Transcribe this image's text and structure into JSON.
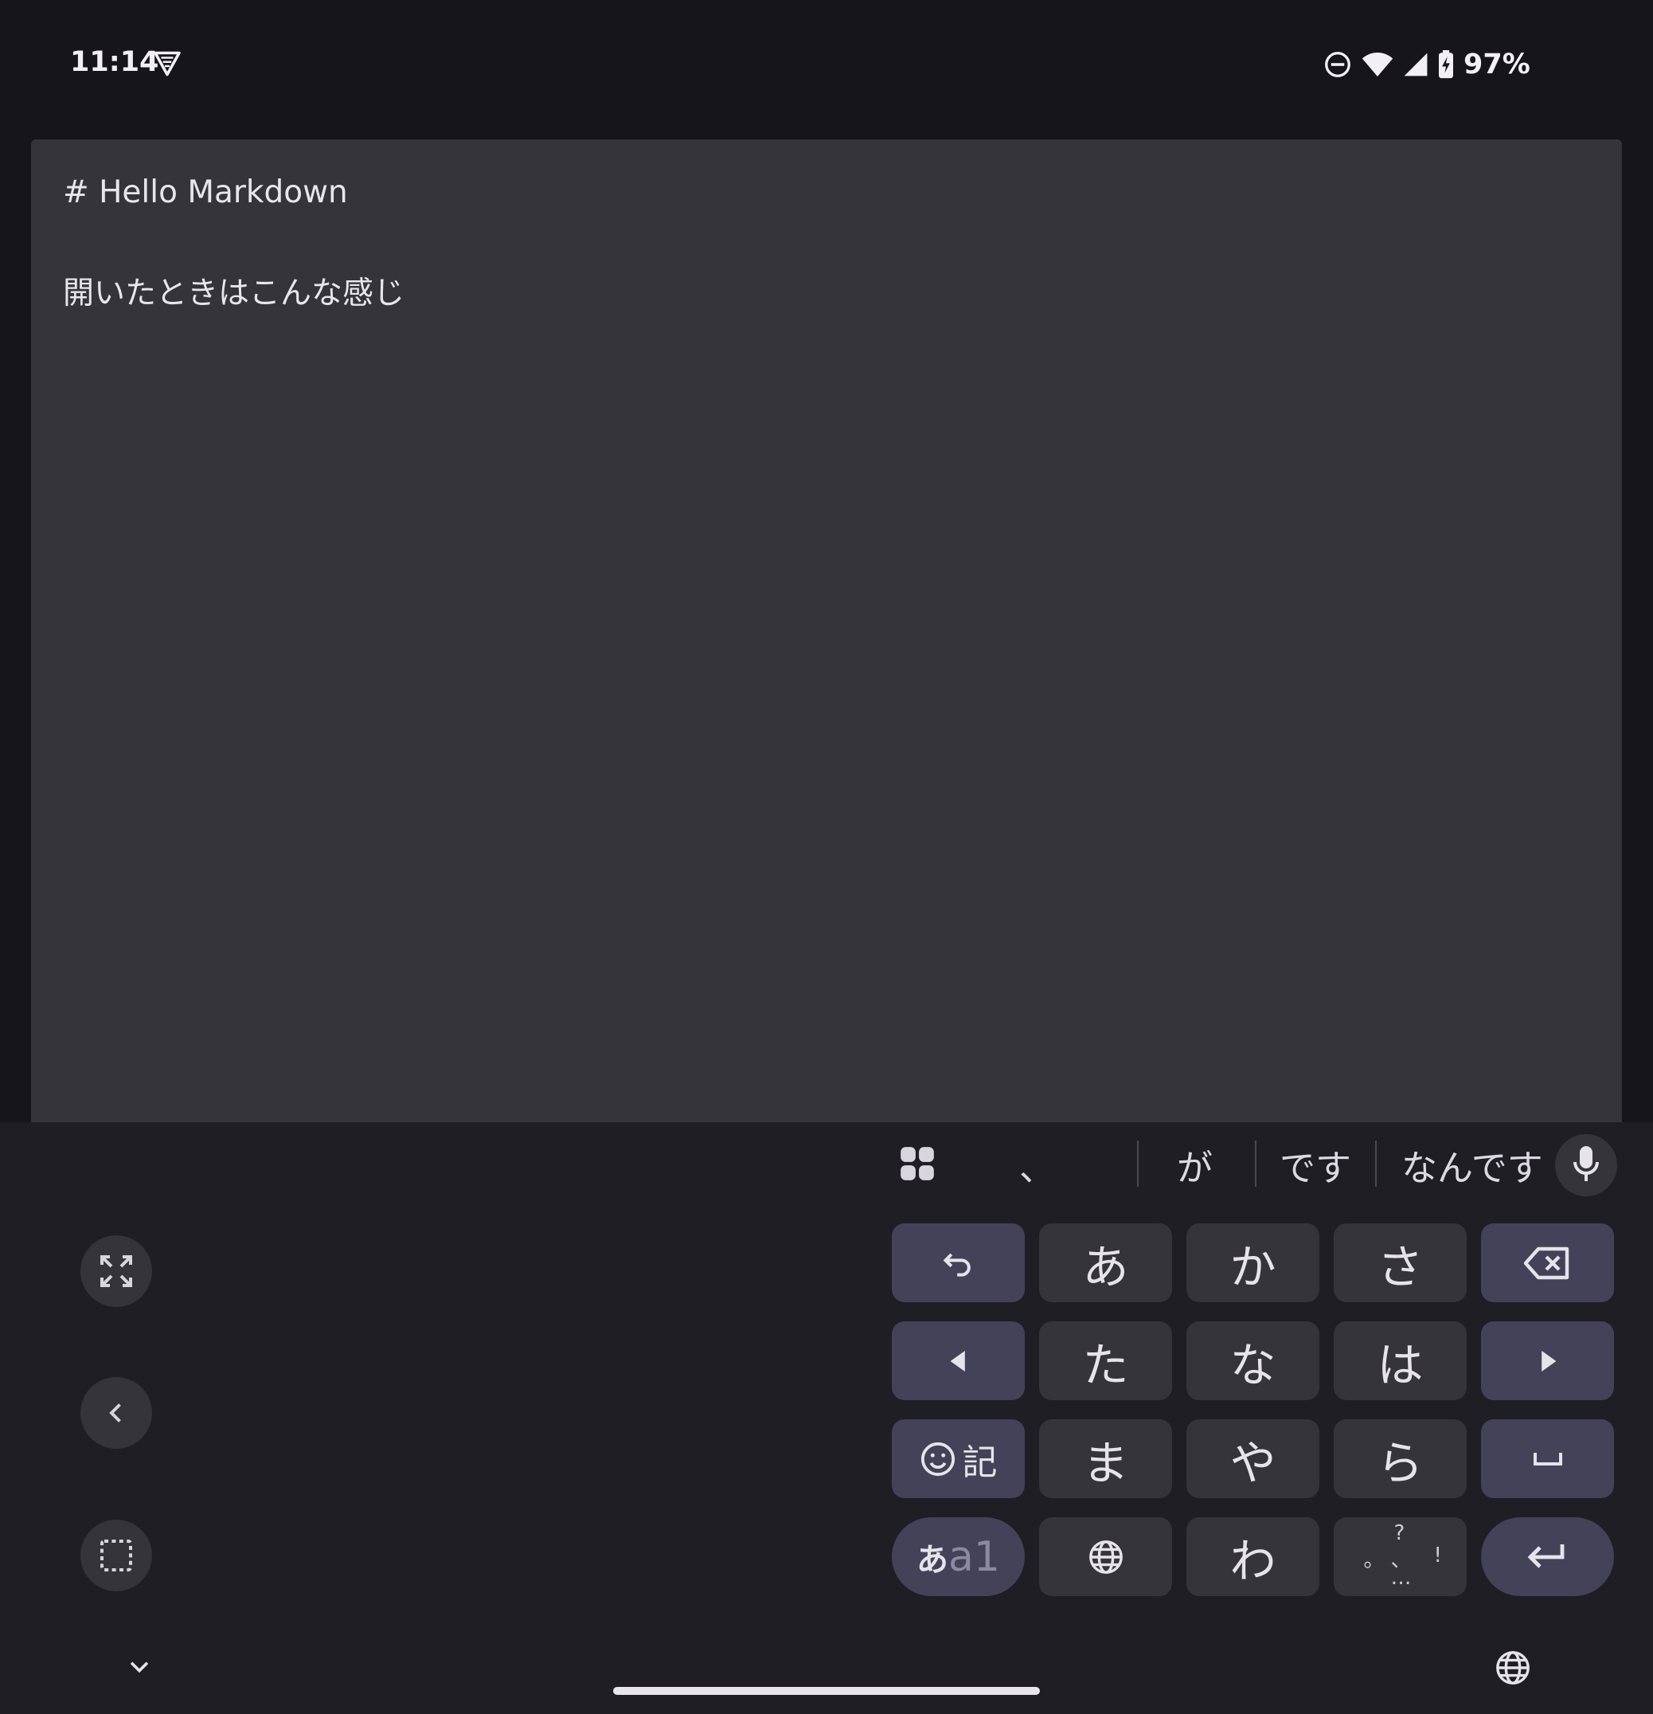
{
  "status_bar": {
    "time": "11:14",
    "battery": "97%"
  },
  "editor": {
    "lines": [
      "# Hello Markdown",
      "開いたときはこんな感じ"
    ]
  },
  "keyboard": {
    "suggestions": [
      "、",
      "が",
      "です",
      "なんです"
    ],
    "rows": [
      [
        "undo",
        "あ",
        "か",
        "さ",
        "backspace"
      ],
      [
        "left",
        "た",
        "な",
        "は",
        "right"
      ],
      [
        "emoji 記",
        "ま",
        "や",
        "ら",
        "space"
      ],
      [
        "あa1",
        "globe",
        "わ",
        "punct",
        "enter"
      ]
    ],
    "labels": {
      "a": "あ",
      "ka": "か",
      "sa": "さ",
      "ta": "た",
      "na": "な",
      "ha": "は",
      "ma": "ま",
      "ya": "や",
      "ra": "ら",
      "wa": "わ",
      "symbol": "記",
      "mode_a": "あ",
      "mode_alpha": "a1",
      "punct_top": "?",
      "punct_left": "。",
      "punct_mid": "、",
      "punct_right": "!",
      "punct_bottom": "…"
    }
  },
  "colors": {
    "background": "#16151b",
    "editor": "#35343b",
    "keyboard": "#1f1e25",
    "key": "#35343b",
    "function_key": "#434258"
  }
}
